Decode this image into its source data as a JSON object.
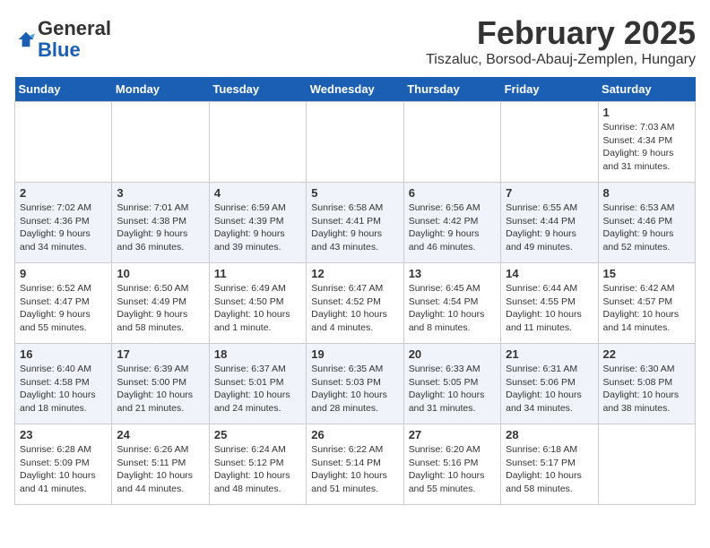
{
  "header": {
    "logo_general": "General",
    "logo_blue": "Blue",
    "month_title": "February 2025",
    "location": "Tiszaluc, Borsod-Abauj-Zemplen, Hungary"
  },
  "weekdays": [
    "Sunday",
    "Monday",
    "Tuesday",
    "Wednesday",
    "Thursday",
    "Friday",
    "Saturday"
  ],
  "weeks": [
    [
      {
        "day": "",
        "info": ""
      },
      {
        "day": "",
        "info": ""
      },
      {
        "day": "",
        "info": ""
      },
      {
        "day": "",
        "info": ""
      },
      {
        "day": "",
        "info": ""
      },
      {
        "day": "",
        "info": ""
      },
      {
        "day": "1",
        "info": "Sunrise: 7:03 AM\nSunset: 4:34 PM\nDaylight: 9 hours and 31 minutes."
      }
    ],
    [
      {
        "day": "2",
        "info": "Sunrise: 7:02 AM\nSunset: 4:36 PM\nDaylight: 9 hours and 34 minutes."
      },
      {
        "day": "3",
        "info": "Sunrise: 7:01 AM\nSunset: 4:38 PM\nDaylight: 9 hours and 36 minutes."
      },
      {
        "day": "4",
        "info": "Sunrise: 6:59 AM\nSunset: 4:39 PM\nDaylight: 9 hours and 39 minutes."
      },
      {
        "day": "5",
        "info": "Sunrise: 6:58 AM\nSunset: 4:41 PM\nDaylight: 9 hours and 43 minutes."
      },
      {
        "day": "6",
        "info": "Sunrise: 6:56 AM\nSunset: 4:42 PM\nDaylight: 9 hours and 46 minutes."
      },
      {
        "day": "7",
        "info": "Sunrise: 6:55 AM\nSunset: 4:44 PM\nDaylight: 9 hours and 49 minutes."
      },
      {
        "day": "8",
        "info": "Sunrise: 6:53 AM\nSunset: 4:46 PM\nDaylight: 9 hours and 52 minutes."
      }
    ],
    [
      {
        "day": "9",
        "info": "Sunrise: 6:52 AM\nSunset: 4:47 PM\nDaylight: 9 hours and 55 minutes."
      },
      {
        "day": "10",
        "info": "Sunrise: 6:50 AM\nSunset: 4:49 PM\nDaylight: 9 hours and 58 minutes."
      },
      {
        "day": "11",
        "info": "Sunrise: 6:49 AM\nSunset: 4:50 PM\nDaylight: 10 hours and 1 minute."
      },
      {
        "day": "12",
        "info": "Sunrise: 6:47 AM\nSunset: 4:52 PM\nDaylight: 10 hours and 4 minutes."
      },
      {
        "day": "13",
        "info": "Sunrise: 6:45 AM\nSunset: 4:54 PM\nDaylight: 10 hours and 8 minutes."
      },
      {
        "day": "14",
        "info": "Sunrise: 6:44 AM\nSunset: 4:55 PM\nDaylight: 10 hours and 11 minutes."
      },
      {
        "day": "15",
        "info": "Sunrise: 6:42 AM\nSunset: 4:57 PM\nDaylight: 10 hours and 14 minutes."
      }
    ],
    [
      {
        "day": "16",
        "info": "Sunrise: 6:40 AM\nSunset: 4:58 PM\nDaylight: 10 hours and 18 minutes."
      },
      {
        "day": "17",
        "info": "Sunrise: 6:39 AM\nSunset: 5:00 PM\nDaylight: 10 hours and 21 minutes."
      },
      {
        "day": "18",
        "info": "Sunrise: 6:37 AM\nSunset: 5:01 PM\nDaylight: 10 hours and 24 minutes."
      },
      {
        "day": "19",
        "info": "Sunrise: 6:35 AM\nSunset: 5:03 PM\nDaylight: 10 hours and 28 minutes."
      },
      {
        "day": "20",
        "info": "Sunrise: 6:33 AM\nSunset: 5:05 PM\nDaylight: 10 hours and 31 minutes."
      },
      {
        "day": "21",
        "info": "Sunrise: 6:31 AM\nSunset: 5:06 PM\nDaylight: 10 hours and 34 minutes."
      },
      {
        "day": "22",
        "info": "Sunrise: 6:30 AM\nSunset: 5:08 PM\nDaylight: 10 hours and 38 minutes."
      }
    ],
    [
      {
        "day": "23",
        "info": "Sunrise: 6:28 AM\nSunset: 5:09 PM\nDaylight: 10 hours and 41 minutes."
      },
      {
        "day": "24",
        "info": "Sunrise: 6:26 AM\nSunset: 5:11 PM\nDaylight: 10 hours and 44 minutes."
      },
      {
        "day": "25",
        "info": "Sunrise: 6:24 AM\nSunset: 5:12 PM\nDaylight: 10 hours and 48 minutes."
      },
      {
        "day": "26",
        "info": "Sunrise: 6:22 AM\nSunset: 5:14 PM\nDaylight: 10 hours and 51 minutes."
      },
      {
        "day": "27",
        "info": "Sunrise: 6:20 AM\nSunset: 5:16 PM\nDaylight: 10 hours and 55 minutes."
      },
      {
        "day": "28",
        "info": "Sunrise: 6:18 AM\nSunset: 5:17 PM\nDaylight: 10 hours and 58 minutes."
      },
      {
        "day": "",
        "info": ""
      }
    ]
  ]
}
